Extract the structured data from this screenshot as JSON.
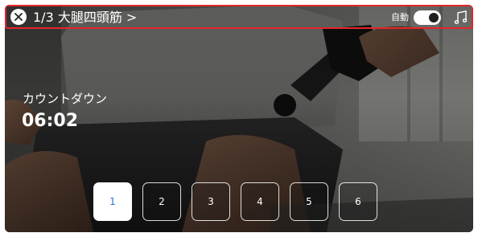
{
  "header": {
    "title": "1/3 大腿四頭筋 >",
    "auto_label": "自動",
    "auto_enabled": true,
    "close_icon": "close-icon",
    "music_icon": "music-note-icon"
  },
  "countdown": {
    "label": "カウントダウン",
    "time": "06:02"
  },
  "steps": {
    "items": [
      "1",
      "2",
      "3",
      "4",
      "5",
      "6"
    ],
    "active_index": 0
  },
  "colors": {
    "highlight_border": "#e5262b",
    "active_step_text": "#2a6fd6"
  }
}
